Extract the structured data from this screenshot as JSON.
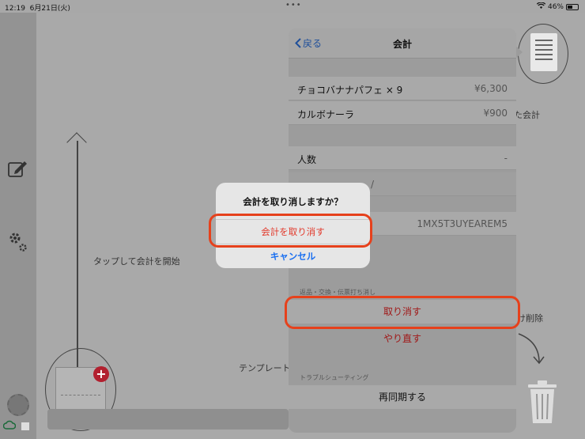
{
  "status_bar": {
    "time": "12:19",
    "date": "6月21日(火)",
    "battery": "46%",
    "battery_level": 0.46
  },
  "canvas": {
    "tap_hint": "タップして会計を開始",
    "template_label": "テンプレート",
    "receipt_label": "た会計",
    "delete_label": "け削除"
  },
  "panel": {
    "back_label": "戻る",
    "title": "会計",
    "items": [
      {
        "name": "チョコバナナパフェ × 9",
        "price": "¥6,300"
      },
      {
        "name": "カルボナーラ",
        "price": "¥900"
      }
    ],
    "people_label": "人数",
    "people_value": "-",
    "section_peek": "/",
    "id_value": "1MX5T3UYEAREM5",
    "return_section_label": "返品・交換・伝票打ち消し",
    "cancel_button": "取り消す",
    "redo_button": "やり直す",
    "trouble_section_label": "トラブルシューティング",
    "resync_button": "再同期する"
  },
  "alert": {
    "title": "会計を取り消しますか？",
    "destructive_button": "会計を取り消す",
    "cancel_button": "キャンセル"
  },
  "colors": {
    "highlight": "#e6411c",
    "destructive": "#e23b2d",
    "link": "#1a6ff0"
  }
}
